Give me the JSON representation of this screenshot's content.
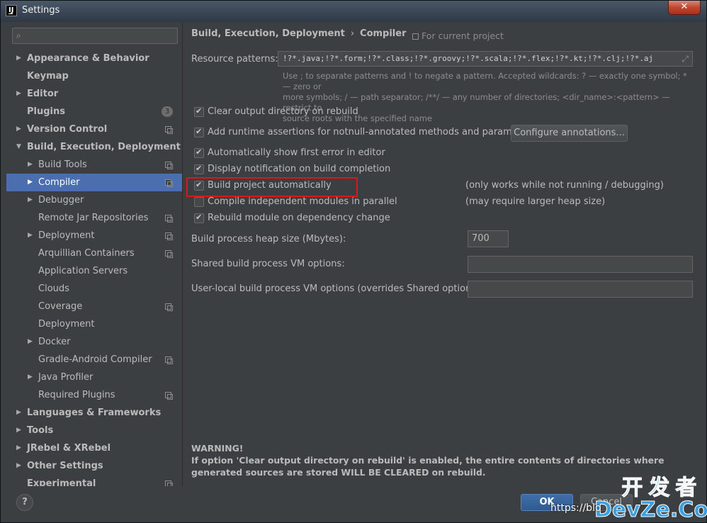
{
  "window": {
    "title": "Settings",
    "close_label": "✕"
  },
  "sidebar": {
    "search_placeholder": "",
    "items": [
      {
        "label": "Appearance & Behavior",
        "level": 0,
        "arrow": "▶",
        "project": false,
        "badge": ""
      },
      {
        "label": "Keymap",
        "level": 0,
        "arrow": "",
        "project": false,
        "badge": ""
      },
      {
        "label": "Editor",
        "level": 0,
        "arrow": "▶",
        "project": false,
        "badge": ""
      },
      {
        "label": "Plugins",
        "level": 0,
        "arrow": "",
        "project": false,
        "badge": "3"
      },
      {
        "label": "Version Control",
        "level": 0,
        "arrow": "▶",
        "project": true,
        "badge": ""
      },
      {
        "label": "Build, Execution, Deployment",
        "level": 0,
        "arrow": "▼",
        "project": false,
        "badge": ""
      },
      {
        "label": "Build Tools",
        "level": 1,
        "arrow": "▶",
        "project": true,
        "badge": ""
      },
      {
        "label": "Compiler",
        "level": 1,
        "arrow": "▶",
        "project": true,
        "badge": "",
        "selected": true
      },
      {
        "label": "Debugger",
        "level": 1,
        "arrow": "▶",
        "project": false,
        "badge": ""
      },
      {
        "label": "Remote Jar Repositories",
        "level": 1,
        "arrow": "",
        "project": true,
        "badge": ""
      },
      {
        "label": "Deployment",
        "level": 1,
        "arrow": "▶",
        "project": true,
        "badge": ""
      },
      {
        "label": "Arquillian Containers",
        "level": 1,
        "arrow": "",
        "project": true,
        "badge": ""
      },
      {
        "label": "Application Servers",
        "level": 1,
        "arrow": "",
        "project": false,
        "badge": ""
      },
      {
        "label": "Clouds",
        "level": 1,
        "arrow": "",
        "project": false,
        "badge": ""
      },
      {
        "label": "Coverage",
        "level": 1,
        "arrow": "",
        "project": true,
        "badge": ""
      },
      {
        "label": "Deployment",
        "level": 1,
        "arrow": "",
        "project": false,
        "badge": ""
      },
      {
        "label": "Docker",
        "level": 1,
        "arrow": "▶",
        "project": false,
        "badge": ""
      },
      {
        "label": "Gradle-Android Compiler",
        "level": 1,
        "arrow": "",
        "project": true,
        "badge": ""
      },
      {
        "label": "Java Profiler",
        "level": 1,
        "arrow": "▶",
        "project": false,
        "badge": ""
      },
      {
        "label": "Required Plugins",
        "level": 1,
        "arrow": "",
        "project": true,
        "badge": ""
      },
      {
        "label": "Languages & Frameworks",
        "level": 0,
        "arrow": "▶",
        "project": false,
        "badge": ""
      },
      {
        "label": "Tools",
        "level": 0,
        "arrow": "▶",
        "project": false,
        "badge": ""
      },
      {
        "label": "JRebel & XRebel",
        "level": 0,
        "arrow": "▶",
        "project": false,
        "badge": ""
      },
      {
        "label": "Other Settings",
        "level": 0,
        "arrow": "▶",
        "project": false,
        "badge": ""
      },
      {
        "label": "Experimental",
        "level": 0,
        "arrow": "",
        "project": true,
        "badge": ""
      }
    ]
  },
  "main": {
    "breadcrumb": [
      "Build, Execution, Deployment",
      "›",
      "Compiler"
    ],
    "for_project": "For current project",
    "resource_patterns_label": "Resource patterns:",
    "resource_patterns_value": "!?*.java;!?*.form;!?*.class;!?*.groovy;!?*.scala;!?*.flex;!?*.kt;!?*.clj;!?*.aj",
    "expand_icon": "⤢",
    "hint_line1": "Use ; to separate patterns and ! to negate a pattern. Accepted wildcards: ? — exactly one symbol; * — zero or",
    "hint_line2": "more symbols; / — path separator; /**/ — any number of directories; <dir_name>:<pattern> — restrict to",
    "hint_line3": "source roots with the specified name",
    "checkboxes": [
      {
        "label": "Clear output directory on rebuild",
        "checked": true
      },
      {
        "label": "Add runtime assertions for notnull-annotated methods and parameters",
        "checked": true
      },
      {
        "label": "Automatically show first error in editor",
        "checked": true
      },
      {
        "label": "Display notification on build completion",
        "checked": true
      },
      {
        "label": "Build project automatically",
        "checked": true
      },
      {
        "label": "Compile independent modules in parallel",
        "checked": false
      },
      {
        "label": "Rebuild module on dependency change",
        "checked": true
      }
    ],
    "configure_annotations_label": "Configure annotations...",
    "note_build_auto": "(only works while not running / debugging)",
    "note_parallel": "(may require larger heap size)",
    "heap_label": "Build process heap size (Mbytes):",
    "heap_value": "700",
    "shared_vm_label": "Shared build process VM options:",
    "shared_vm_value": "",
    "user_vm_label": "User-local build process VM options (overrides Shared options):",
    "user_vm_value": "",
    "warning_title": "WARNING!",
    "warning_text": "If option 'Clear output directory on rebuild' is enabled, the entire contents of directories where generated sources are stored WILL BE CLEARED on rebuild."
  },
  "footer": {
    "help_label": "?",
    "ok_label": "OK",
    "cancel_label": "Cancel"
  },
  "watermark": {
    "url": "https://blo",
    "logo_cn": "开发者",
    "logo_en": "DevZe.CoM"
  },
  "colors": {
    "selection": "#4b6eaf",
    "highlight_box": "#e01515",
    "ok_button": "#365f95"
  }
}
